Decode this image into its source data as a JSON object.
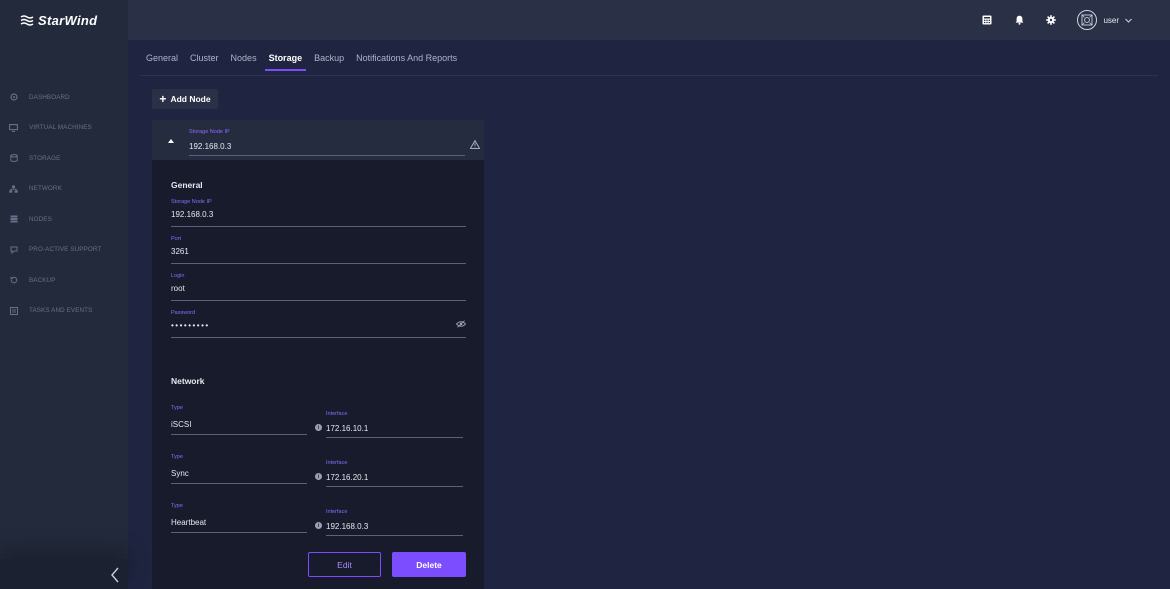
{
  "app": {
    "name": "StarWind"
  },
  "sidebar": {
    "items": [
      {
        "label": "DASHBOARD",
        "icon": "dashboard-icon"
      },
      {
        "label": "VIRTUAL MACHINES",
        "icon": "virtual-machines-icon"
      },
      {
        "label": "STORAGE",
        "icon": "storage-icon"
      },
      {
        "label": "NETWORK",
        "icon": "network-icon"
      },
      {
        "label": "NODES",
        "icon": "nodes-icon"
      },
      {
        "label": "PRO-ACTIVE SUPPORT",
        "icon": "support-icon"
      },
      {
        "label": "BACKUP",
        "icon": "backup-icon"
      },
      {
        "label": "TASKS AND EVENTS",
        "icon": "tasks-icon"
      }
    ]
  },
  "topbar": {
    "user_name": "user"
  },
  "tabs": [
    {
      "label": "General"
    },
    {
      "label": "Cluster"
    },
    {
      "label": "Nodes"
    },
    {
      "label": "Storage",
      "active": true
    },
    {
      "label": "Backup"
    },
    {
      "label": "Notifications And Reports"
    }
  ],
  "add_node_label": "Add Node",
  "panel": {
    "header": {
      "label": "Storage Node IP",
      "value": "192.168.0.3"
    },
    "general": {
      "title": "General",
      "storage_ip": {
        "label": "Storage Node IP",
        "value": "192.168.0.3"
      },
      "port": {
        "label": "Port",
        "value": "3261"
      },
      "login": {
        "label": "Login",
        "value": "root"
      },
      "password": {
        "label": "Password",
        "value": "•••••••••"
      }
    },
    "network": {
      "title": "Network",
      "rows": [
        {
          "type_label": "Type",
          "type": "iSCSI",
          "iface_label": "Interface",
          "iface": "172.16.10.1"
        },
        {
          "type_label": "Type",
          "type": "Sync",
          "iface_label": "Interface",
          "iface": "172.16.20.1"
        },
        {
          "type_label": "Type",
          "type": "Heartbeat",
          "iface_label": "Interface",
          "iface": "192.168.0.3"
        }
      ]
    },
    "edit_label": "Edit",
    "delete_label": "Delete"
  },
  "colors": {
    "accent": "#7b4dff",
    "background": "#1f2440",
    "sidebar": "#232a3b",
    "panel": "#171b2b"
  }
}
